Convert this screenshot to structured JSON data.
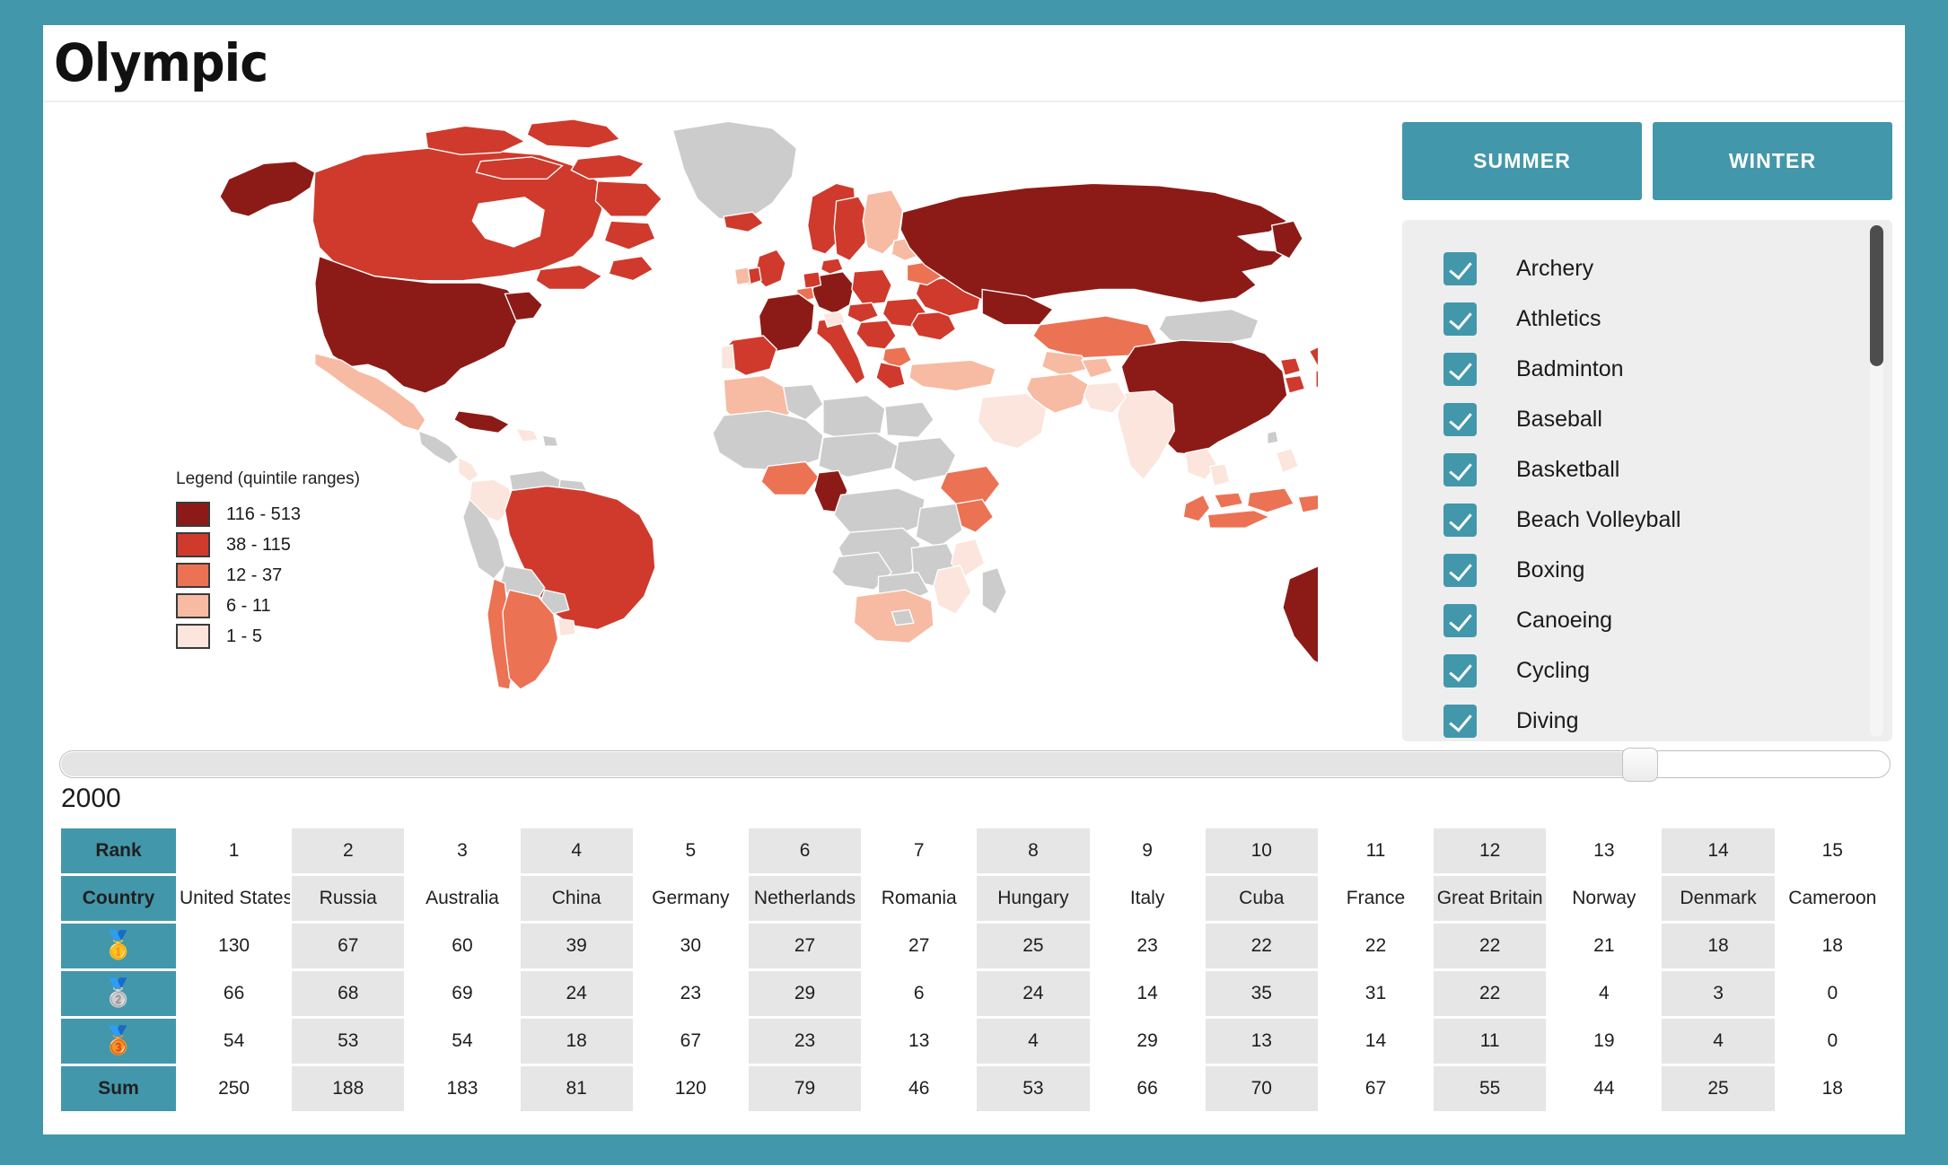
{
  "theme": {
    "accent": "#4397ab",
    "page_background": "#4397ab",
    "panel_background": "#ffffff",
    "list_background": "#eeeeee",
    "alt_cell": "#e6e6e6",
    "scrollbar_thumb": "#4d4d4d"
  },
  "header": {
    "title": "Olympic"
  },
  "season_buttons": [
    {
      "label": "SUMMER",
      "name": "summer-button"
    },
    {
      "label": "WINTER",
      "name": "winter-button"
    }
  ],
  "legend": {
    "title": "Legend (quintile ranges)",
    "entries": [
      {
        "label": "116 - 513",
        "color": "#8c1b17"
      },
      {
        "label": "38 - 115",
        "color": "#cf3a2c"
      },
      {
        "label": "12 - 37",
        "color": "#ec7254"
      },
      {
        "label": "6 - 11",
        "color": "#f6bba2"
      },
      {
        "label": "1 - 5",
        "color": "#fbe5dc"
      }
    ],
    "no_data_color": "#cccccc"
  },
  "sports": [
    {
      "label": "Archery",
      "checked": true
    },
    {
      "label": "Athletics",
      "checked": true
    },
    {
      "label": "Badminton",
      "checked": true
    },
    {
      "label": "Baseball",
      "checked": true
    },
    {
      "label": "Basketball",
      "checked": true
    },
    {
      "label": "Beach Volleyball",
      "checked": true
    },
    {
      "label": "Boxing",
      "checked": true
    },
    {
      "label": "Canoeing",
      "checked": true
    },
    {
      "label": "Cycling",
      "checked": true
    },
    {
      "label": "Diving",
      "checked": true
    }
  ],
  "year_slider": {
    "value": "2000",
    "label": "2000",
    "fill_percent": 85
  },
  "table": {
    "row_labels": {
      "rank": "Rank",
      "country": "Country",
      "gold": "gold-medal",
      "silver": "silver-medal",
      "bronze": "bronze-medal",
      "sum": "Sum"
    },
    "medal_glyphs": {
      "gold": "🥇",
      "silver": "🥈",
      "bronze": "🥉"
    },
    "ranks": [
      "1",
      "2",
      "3",
      "4",
      "5",
      "6",
      "7",
      "8",
      "9",
      "10",
      "11",
      "12",
      "13",
      "14",
      "15"
    ],
    "countries": [
      "United States",
      "Russia",
      "Australia",
      "China",
      "Germany",
      "Netherlands",
      "Romania",
      "Hungary",
      "Italy",
      "Cuba",
      "France",
      "Great Britain",
      "Norway",
      "Denmark",
      "Cameroon"
    ],
    "gold": [
      "130",
      "67",
      "60",
      "39",
      "30",
      "27",
      "27",
      "25",
      "23",
      "22",
      "22",
      "22",
      "21",
      "18",
      "18"
    ],
    "silver": [
      "66",
      "68",
      "69",
      "24",
      "23",
      "29",
      "6",
      "24",
      "14",
      "35",
      "31",
      "22",
      "4",
      "3",
      "0"
    ],
    "bronze": [
      "54",
      "53",
      "54",
      "18",
      "67",
      "23",
      "13",
      "4",
      "29",
      "13",
      "14",
      "11",
      "19",
      "4",
      "0"
    ],
    "sum": [
      "250",
      "188",
      "183",
      "81",
      "120",
      "79",
      "46",
      "53",
      "66",
      "70",
      "67",
      "55",
      "44",
      "25",
      "18"
    ]
  },
  "chart_data": {
    "type": "heatmap",
    "title": "Olympic medal counts by country (choropleth world map)",
    "subtitle": "2000 Summer Olympics — all sports selected",
    "legend_title": "Legend (quintile ranges)",
    "bins": [
      {
        "range": "116 - 513",
        "min": 116,
        "max": 513,
        "color": "#8c1b17"
      },
      {
        "range": "38 - 115",
        "min": 38,
        "max": 115,
        "color": "#cf3a2c"
      },
      {
        "range": "12 - 37",
        "min": 12,
        "max": 37,
        "color": "#ec7254"
      },
      {
        "range": "6 - 11",
        "min": 6,
        "max": 11,
        "color": "#f6bba2"
      },
      {
        "range": "1 - 5",
        "min": 1,
        "max": 5,
        "color": "#fbe5dc"
      }
    ],
    "categories": [
      "United States",
      "Russia",
      "Australia",
      "China",
      "Germany",
      "Netherlands",
      "Romania",
      "Hungary",
      "Italy",
      "Cuba",
      "France",
      "Great Britain",
      "Norway",
      "Denmark",
      "Cameroon"
    ],
    "series": [
      {
        "name": "Gold",
        "values": [
          130,
          67,
          60,
          39,
          30,
          27,
          27,
          25,
          23,
          22,
          22,
          22,
          21,
          18,
          18
        ]
      },
      {
        "name": "Silver",
        "values": [
          66,
          68,
          69,
          24,
          23,
          29,
          6,
          24,
          14,
          35,
          31,
          22,
          4,
          3,
          0
        ]
      },
      {
        "name": "Bronze",
        "values": [
          54,
          53,
          54,
          18,
          67,
          23,
          13,
          4,
          29,
          13,
          14,
          11,
          19,
          4,
          0
        ]
      },
      {
        "name": "Sum",
        "values": [
          250,
          188,
          183,
          81,
          120,
          79,
          46,
          53,
          66,
          70,
          67,
          55,
          44,
          25,
          18
        ]
      }
    ]
  }
}
